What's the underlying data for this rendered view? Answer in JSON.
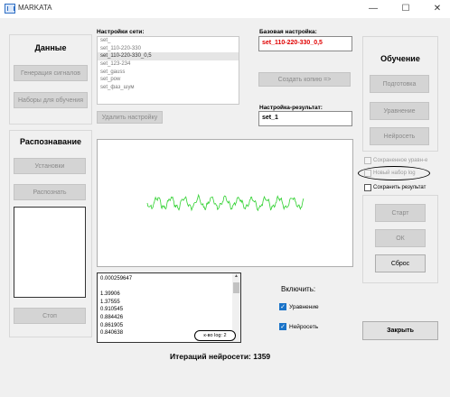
{
  "window": {
    "title": "MARKATA",
    "minimize": "—",
    "maximize": "☐",
    "close": "✕"
  },
  "data_panel": {
    "title": "Данные",
    "gen_button": "Генерация сигналов",
    "sets_button": "Наборы для обучения"
  },
  "recog_panel": {
    "title": "Распознавание",
    "settings_button": "Установки",
    "recognize_button": "Распознать",
    "stop_button": "Стоп"
  },
  "network": {
    "label": "Настройки сети:",
    "items": [
      "set_",
      "set_110-220-330",
      "set_110-220-330_0,5",
      "set_123-234",
      "set_gauss",
      "set_pow",
      "set_фаз_шум"
    ],
    "selected_index": 2,
    "delete_button": "Удалить настройку"
  },
  "base": {
    "label": "Базовая настройка:",
    "value": "set_110-220-330_0,5",
    "value_color": "#e00000",
    "copy_button": "Создать копию  =>"
  },
  "result": {
    "label": "Настройка-результат:",
    "value": "set_1"
  },
  "log": {
    "lines": [
      "0.000259647",
      "",
      "1.39906",
      "1.37555",
      "0.910545",
      "0.884426",
      "0.861905",
      "0.840638"
    ],
    "count_badge": "к-во log: 2"
  },
  "include": {
    "label": "Включить:",
    "equation": "Уравнение",
    "network": "Нейросеть",
    "equation_checked": true,
    "network_checked": true
  },
  "close_button": "Закрыть",
  "iterations": "Итераций нейросети: 1359",
  "training": {
    "title": "Обучение",
    "prep_button": "Подготовка",
    "equation_button": "Уравнение",
    "network_button": "Нейросеть",
    "saved_eq": "Сохраненное уравн-е",
    "new_log": "Новый набор log",
    "save_result": "Сохранить результат",
    "start_button": "Старт",
    "ok_button": "ОК",
    "reset_button": "Сброс"
  },
  "colors": {
    "signal": "#2fd12f",
    "accent_red": "#e00000",
    "check_blue": "#1a73c8"
  }
}
